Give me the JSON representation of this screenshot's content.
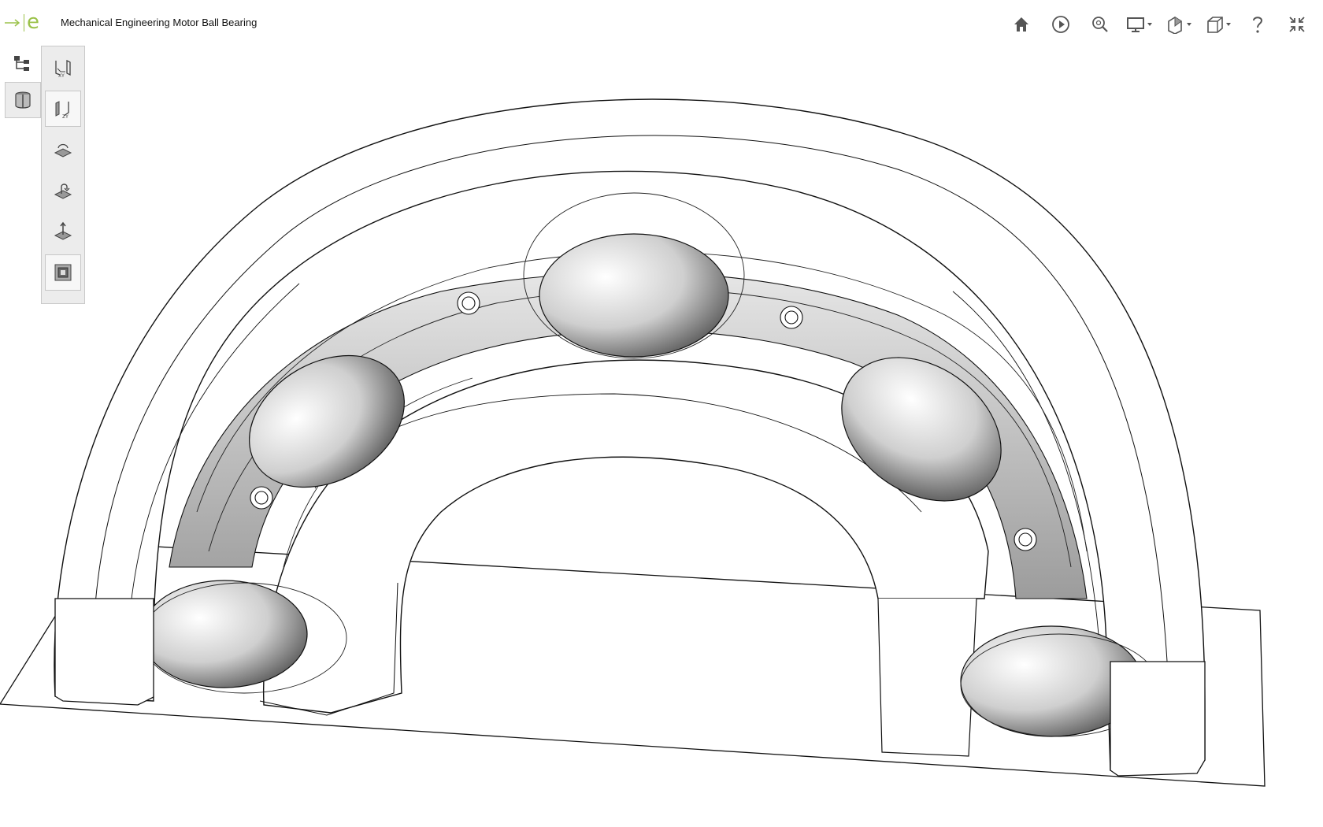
{
  "app": {
    "logo_letter": "e",
    "title": "Mechanical Engineering Motor Ball Bearing",
    "accent_color": "#9bc24a"
  },
  "toolbar": {
    "items": [
      {
        "icon": "home-icon"
      },
      {
        "icon": "play-icon"
      },
      {
        "icon": "zoom-fit-icon"
      },
      {
        "icon": "display-mode-icon",
        "has_menu": true
      },
      {
        "icon": "section-view-icon",
        "has_menu": true
      },
      {
        "icon": "view-orientation-icon",
        "has_menu": true
      },
      {
        "icon": "help-icon"
      },
      {
        "icon": "exit-fullscreen-icon"
      }
    ]
  },
  "side_tools": {
    "items": [
      {
        "icon": "model-tree-icon",
        "active": false
      },
      {
        "icon": "cross-section-icon",
        "active": true
      }
    ]
  },
  "section_panel": {
    "items": [
      {
        "icon": "section-plane-xy-icon",
        "selected": false
      },
      {
        "icon": "section-plane-zy-icon",
        "selected": true
      },
      {
        "icon": "section-plane-zx-icon",
        "selected": false
      },
      {
        "icon": "flip-section-icon",
        "selected": false
      },
      {
        "icon": "move-section-icon",
        "selected": false
      },
      {
        "icon": "section-cap-icon",
        "selected": true
      }
    ]
  }
}
